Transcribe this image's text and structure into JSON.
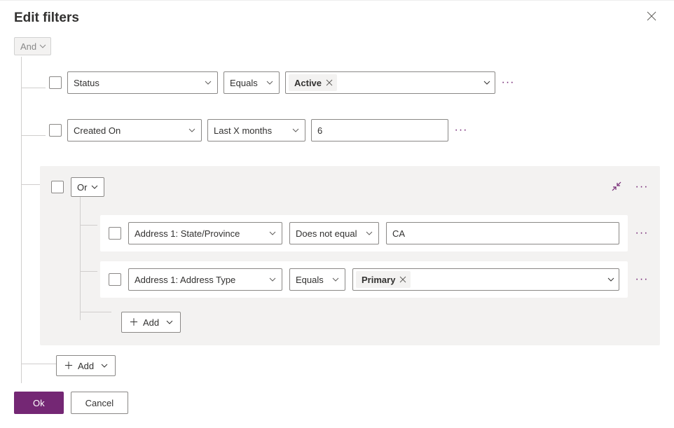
{
  "title": "Edit filters",
  "root_condition": "And",
  "rows": [
    {
      "field": "Status",
      "op": "Equals",
      "value_tag": "Active"
    },
    {
      "field": "Created On",
      "op": "Last X months",
      "value_text": "6"
    }
  ],
  "group": {
    "condition": "Or",
    "rows": [
      {
        "field": "Address 1: State/Province",
        "op": "Does not equal",
        "value_text": "CA"
      },
      {
        "field": "Address 1: Address Type",
        "op": "Equals",
        "value_tag": "Primary"
      }
    ],
    "add_label": "Add"
  },
  "add_label": "Add",
  "buttons": {
    "ok": "Ok",
    "cancel": "Cancel"
  }
}
